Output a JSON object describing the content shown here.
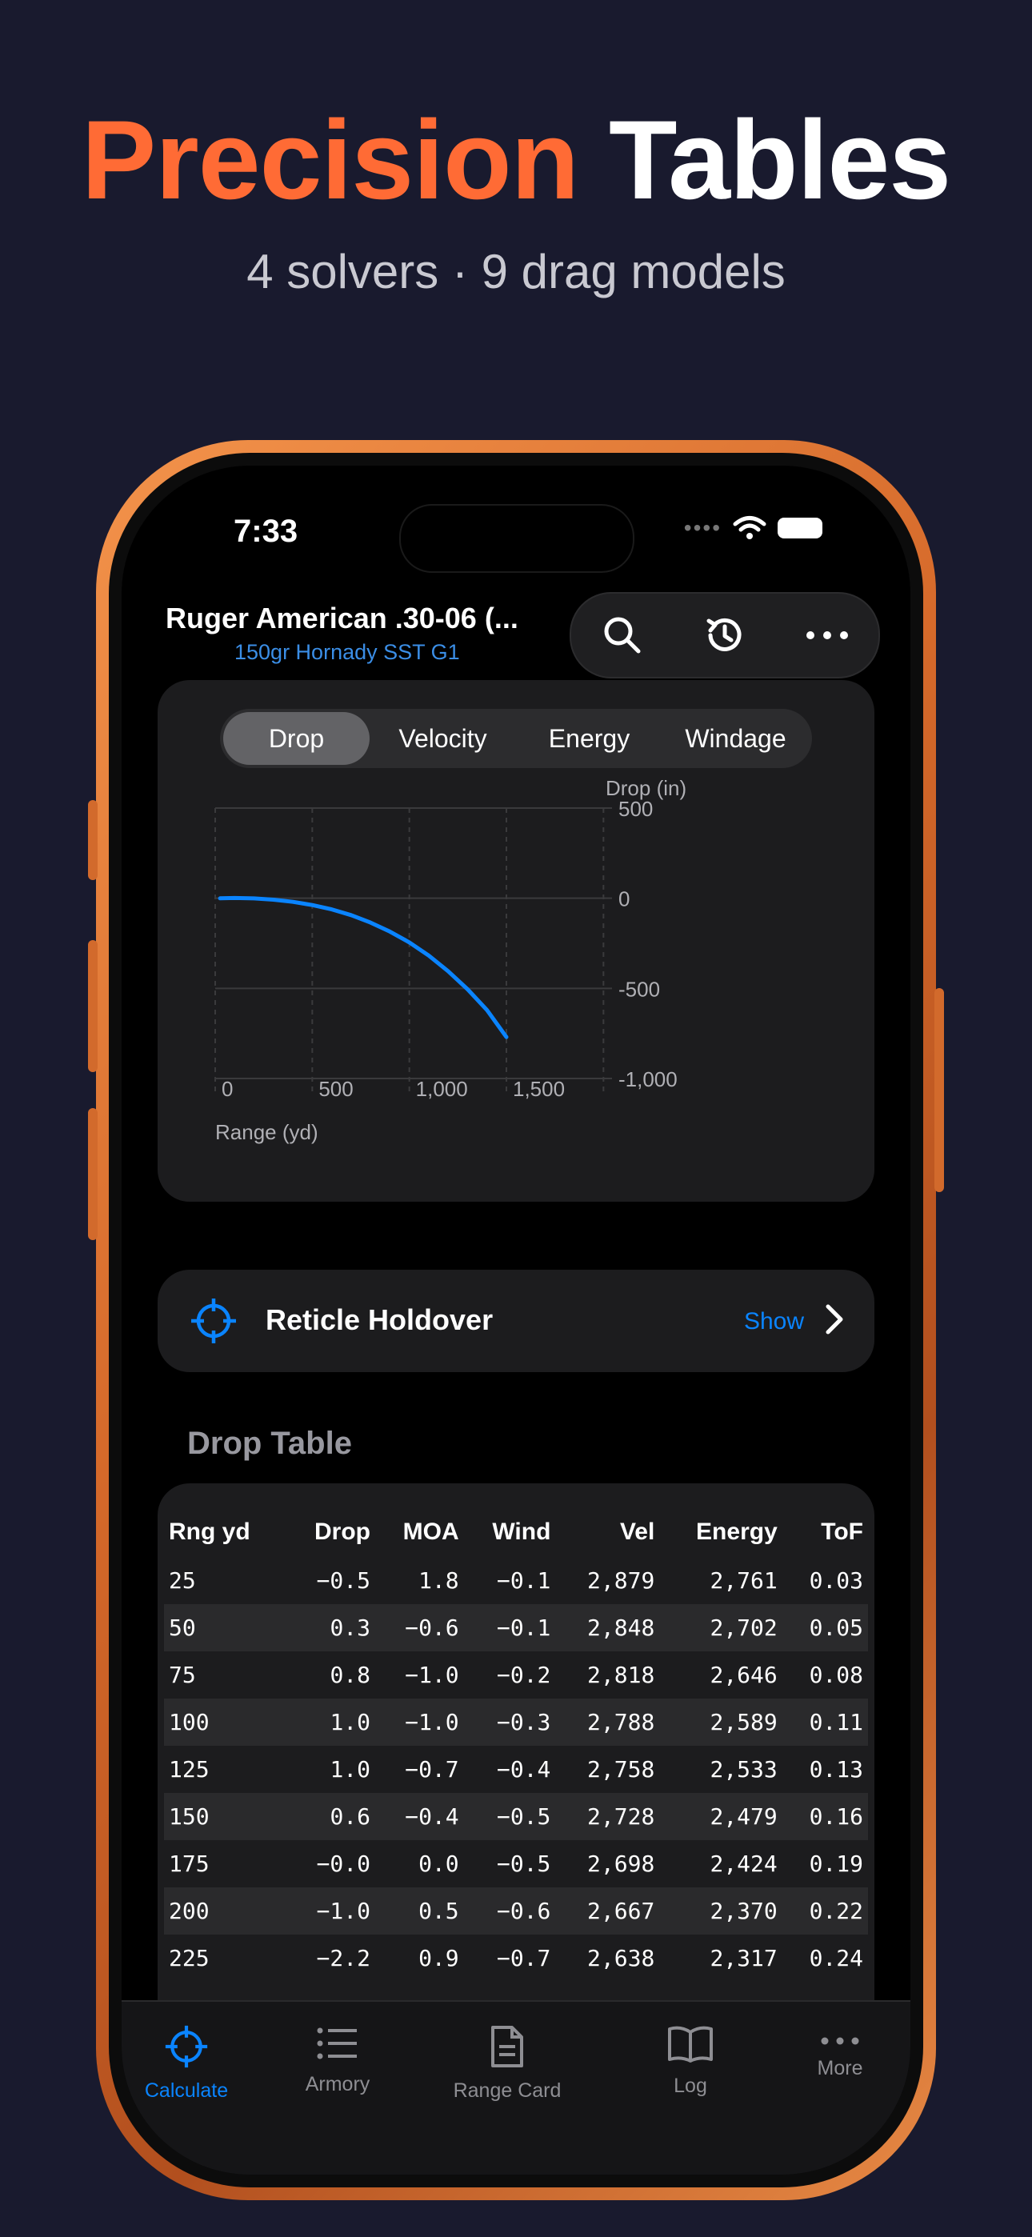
{
  "headline": {
    "accent": "Precision",
    "plain": " Tables"
  },
  "subhead": "4 solvers · 9 drag models",
  "status": {
    "time": "7:33"
  },
  "header": {
    "title": "Ruger American .30-06 (...",
    "subtitle": "150gr Hornady SST G1",
    "icons": [
      "search-icon",
      "history-icon",
      "more-icon"
    ]
  },
  "segments": [
    "Drop",
    "Velocity",
    "Energy",
    "Windage"
  ],
  "active_segment": 0,
  "chart_data": {
    "type": "line",
    "title": "",
    "xlabel": "Range (yd)",
    "ylabel": "Drop (in)",
    "xlim": [
      0,
      1500
    ],
    "ylim": [
      -1000,
      500
    ],
    "x_ticks": [
      "0",
      "500",
      "1,000",
      "1,500"
    ],
    "x_tick_values": [
      0,
      500,
      1000,
      1500
    ],
    "y_ticks": [
      "500",
      "0",
      "-500",
      "-1,000"
    ],
    "y_tick_values": [
      500,
      0,
      -500,
      -1000
    ],
    "series": [
      {
        "color": "#0a84ff",
        "x": [
          25,
          100,
          200,
          300,
          400,
          500,
          600,
          700,
          800,
          900,
          1000,
          1100,
          1200,
          1300,
          1400,
          1500
        ],
        "y": [
          -0.5,
          1.0,
          -1.0,
          -8,
          -20,
          -38,
          -62,
          -94,
          -135,
          -185,
          -245,
          -318,
          -405,
          -505,
          -620,
          -770
        ]
      }
    ],
    "grid": true
  },
  "reticle": {
    "label": "Reticle Holdover",
    "action": "Show"
  },
  "table": {
    "title": "Drop Table",
    "columns": [
      "Rng yd",
      "Drop",
      "MOA",
      "Wind",
      "Vel",
      "Energy",
      "ToF"
    ],
    "rows": [
      [
        "25",
        "−0.5",
        "1.8",
        "−0.1",
        "2,879",
        "2,761",
        "0.03"
      ],
      [
        "50",
        "0.3",
        "−0.6",
        "−0.1",
        "2,848",
        "2,702",
        "0.05"
      ],
      [
        "75",
        "0.8",
        "−1.0",
        "−0.2",
        "2,818",
        "2,646",
        "0.08"
      ],
      [
        "100",
        "1.0",
        "−1.0",
        "−0.3",
        "2,788",
        "2,589",
        "0.11"
      ],
      [
        "125",
        "1.0",
        "−0.7",
        "−0.4",
        "2,758",
        "2,533",
        "0.13"
      ],
      [
        "150",
        "0.6",
        "−0.4",
        "−0.5",
        "2,728",
        "2,479",
        "0.16"
      ],
      [
        "175",
        "−0.0",
        "0.0",
        "−0.5",
        "2,698",
        "2,424",
        "0.19"
      ],
      [
        "200",
        "−1.0",
        "0.5",
        "−0.6",
        "2,667",
        "2,370",
        "0.22"
      ],
      [
        "225",
        "−2.2",
        "0.9",
        "−0.7",
        "2,638",
        "2,317",
        "0.24"
      ]
    ]
  },
  "tabs": [
    {
      "label": "Calculate",
      "icon": "crosshair-icon",
      "active": true
    },
    {
      "label": "Armory",
      "icon": "list-icon",
      "active": false
    },
    {
      "label": "Range Card",
      "icon": "document-icon",
      "active": false
    },
    {
      "label": "Log",
      "icon": "book-icon",
      "active": false
    },
    {
      "label": "More",
      "icon": "more-icon",
      "active": false
    }
  ],
  "colors": {
    "accent": "#ff6b35",
    "link": "#0a84ff",
    "background": "#191a2e"
  }
}
